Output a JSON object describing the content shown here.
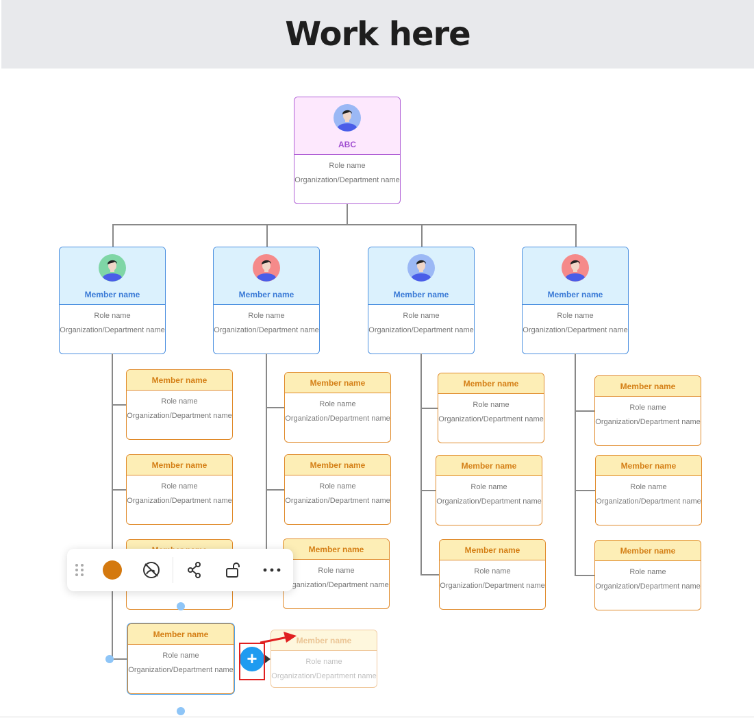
{
  "header": {
    "title": "Work here"
  },
  "root": {
    "name": "ABC",
    "role": "Role name",
    "org": "Organization/Department name"
  },
  "level1": [
    {
      "name": "Member name",
      "role": "Role name",
      "org": "Organization/Department name",
      "avatar_bg": "#7fd6a6"
    },
    {
      "name": "Member name",
      "role": "Role name",
      "org": "Organization/Department name",
      "avatar_bg": "#f58a8a"
    },
    {
      "name": "Member name",
      "role": "Role name",
      "org": "Organization/Department name",
      "avatar_bg": "#9bb8f5"
    },
    {
      "name": "Member name",
      "role": "Role name",
      "org": "Organization/Department name",
      "avatar_bg": "#f58a8a"
    }
  ],
  "member": {
    "name": "Member name",
    "role": "Role name",
    "org": "Organization/Department name"
  },
  "ghost": {
    "name": "Member name",
    "role": "Role name",
    "org": "Organization/Department name"
  },
  "toolbar": {
    "fill_color": "#d4790f",
    "icons": [
      "drag-handle-icon",
      "fill-color-icon",
      "hide-style-icon",
      "connection-icon",
      "unlock-icon",
      "more-icon"
    ]
  },
  "colors": {
    "accent": "#1e9bf0",
    "highlight": "#e02020"
  }
}
